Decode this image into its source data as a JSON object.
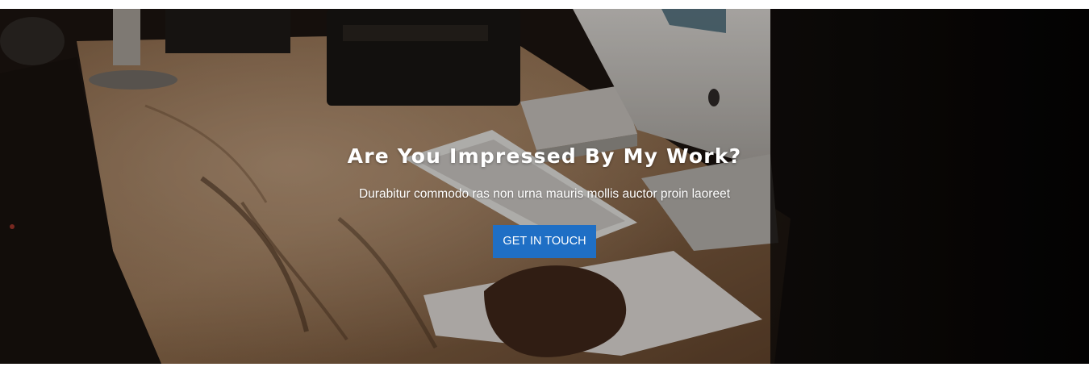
{
  "cta": {
    "heading": "Are You Impressed By My Work?",
    "subtext": "Durabitur commodo ras non urna mauris mollis auctor proin laoreet",
    "button_label": "GET IN TOUCH"
  },
  "colors": {
    "button_bg": "#1f6fc5",
    "text": "#ffffff"
  }
}
